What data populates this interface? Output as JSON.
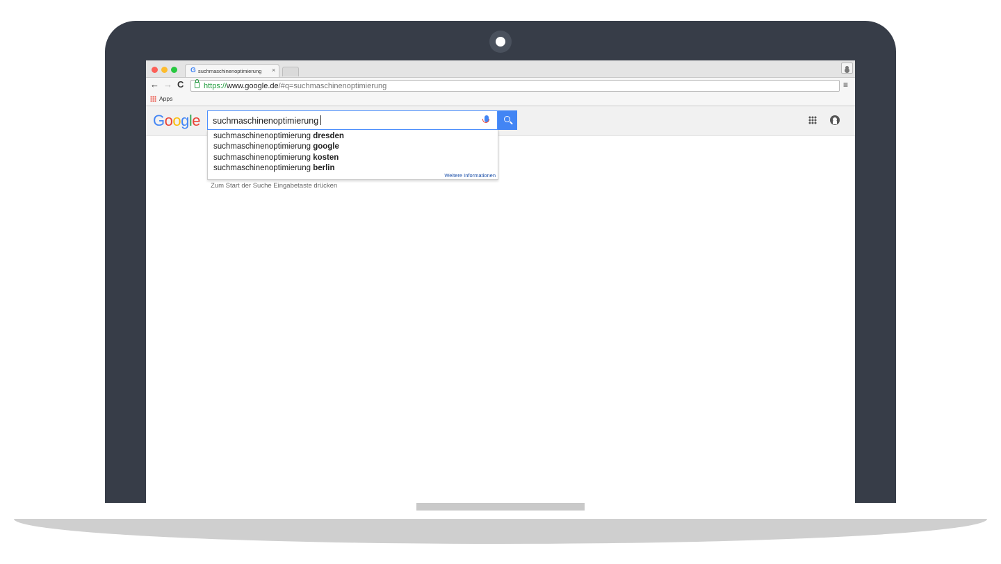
{
  "browser": {
    "tab_title": "suchmaschinenoptimierung",
    "tab_close": "×",
    "url_scheme": "https://",
    "url_host": "www.google.de",
    "url_path": "/#q=suchmaschinenoptimierung",
    "bookmarks": {
      "apps_label": "Apps"
    }
  },
  "google": {
    "logo_letters": [
      "G",
      "o",
      "o",
      "g",
      "l",
      "e"
    ],
    "logo_colors": [
      "#4285f4",
      "#ea4335",
      "#fbbc05",
      "#4285f4",
      "#34a853",
      "#ea4335"
    ],
    "query": "suchmaschinenoptimierung",
    "suggestions": [
      {
        "prefix": "suchmaschinenoptimierung ",
        "completion": "dresden"
      },
      {
        "prefix": "suchmaschinenoptimierung ",
        "completion": "google"
      },
      {
        "prefix": "suchmaschinenoptimierung ",
        "completion": "kosten"
      },
      {
        "prefix": "suchmaschinenoptimierung ",
        "completion": "berlin"
      }
    ],
    "more_info": "Weitere Informationen",
    "hint": "Zum Start der Suche Eingabetaste drücken"
  },
  "icons": {
    "back": "←",
    "forward": "→",
    "reload": "C",
    "star": "☆",
    "menu": "≡"
  },
  "colors": {
    "laptop_frame": "#373d48",
    "accent": "#4285f4",
    "url_secure": "#1f9d3c"
  }
}
